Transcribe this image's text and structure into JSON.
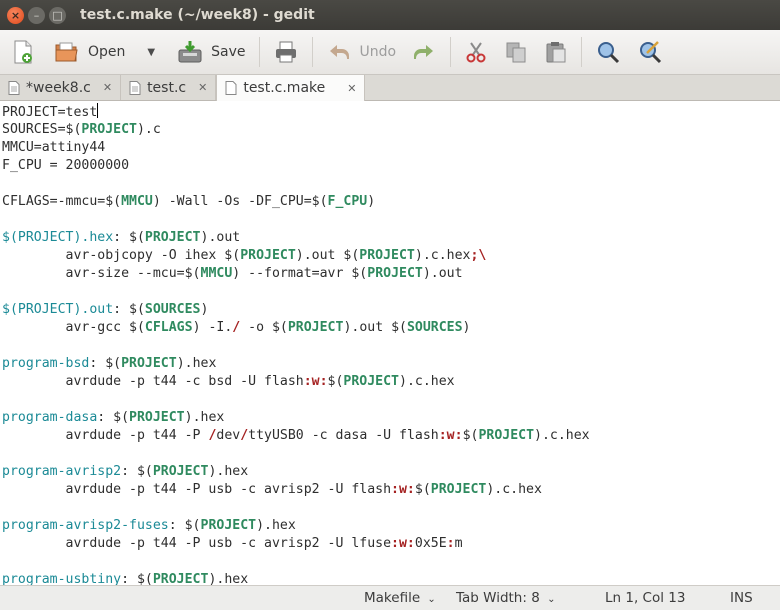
{
  "window": {
    "title": "test.c.make (~/week8) - gedit"
  },
  "toolbar": {
    "new_icon": "new-document-icon",
    "open_label": "Open",
    "save_label": "Save",
    "undo_label": "Undo"
  },
  "tabs": [
    {
      "label": "*week8.c"
    },
    {
      "label": "test.c"
    },
    {
      "label": "test.c.make"
    }
  ],
  "editor": {
    "lines": [
      "PROJECT=test",
      "SOURCES=$(PROJECT).c",
      "MMCU=attiny44",
      "F_CPU = 20000000",
      "",
      "CFLAGS=-mmcu=$(MMCU) -Wall -Os -DF_CPU=$(F_CPU)",
      "",
      "$(PROJECT).hex: $(PROJECT).out",
      "        avr-objcopy -O ihex $(PROJECT).out $(PROJECT).c.hex;\\",
      "        avr-size --mcu=$(MMCU) --format=avr $(PROJECT).out",
      "",
      "$(PROJECT).out: $(SOURCES)",
      "        avr-gcc $(CFLAGS) -I./ -o $(PROJECT).out $(SOURCES)",
      "",
      "program-bsd: $(PROJECT).hex",
      "        avrdude -p t44 -c bsd -U flash:w:$(PROJECT).c.hex",
      "",
      "program-dasa: $(PROJECT).hex",
      "        avrdude -p t44 -P /dev/ttyUSB0 -c dasa -U flash:w:$(PROJECT).c.hex",
      "",
      "program-avrisp2: $(PROJECT).hex",
      "        avrdude -p t44 -P usb -c avrisp2 -U flash:w:$(PROJECT).c.hex",
      "",
      "program-avrisp2-fuses: $(PROJECT).hex",
      "        avrdude -p t44 -P usb -c avrisp2 -U lfuse:w:0x5E:m",
      "",
      "program-usbtiny: $(PROJECT).hex"
    ]
  },
  "statusbar": {
    "language": "Makefile",
    "tab_width": "Tab Width: 8",
    "position": "Ln 1, Col 13",
    "mode": "INS"
  },
  "colors": {
    "target": "#1b8a96",
    "variable": "#2f8a5f",
    "symbol": "#a52222",
    "close_button": "#e0491a"
  }
}
